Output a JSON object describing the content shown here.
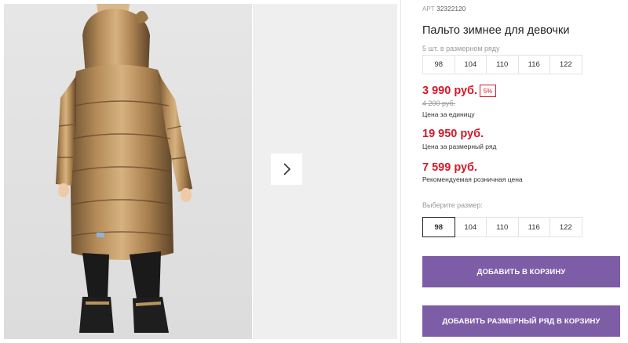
{
  "gallery": {
    "photo_alt": "girl in metallic gold winter coat, back view",
    "next_icon": "chevron-right-icon",
    "next_label": "›"
  },
  "product": {
    "article_label": "АРТ",
    "article_number": "32322120",
    "title": "Пальто зимнее для девочки",
    "pack_label": "5 шт. в размерном ряду",
    "pack_sizes": [
      "98",
      "104",
      "110",
      "116",
      "122"
    ],
    "unit_price": "3 990 руб.",
    "discount": "5%",
    "old_price": "4 200 руб.",
    "unit_price_note": "Цена за единицу",
    "pack_price": "19 950 руб.",
    "pack_price_note": "Цена за размерный ряд",
    "retail_price": "7 599 руб.",
    "retail_price_note": "Рекомендуемая розничная цена",
    "choose_size_label": "Выберите размер:",
    "sizes": [
      "98",
      "104",
      "110",
      "116",
      "122"
    ],
    "selected_size": "98",
    "add_to_cart": "ДОБАВИТЬ В КОРЗИНУ",
    "add_pack_to_cart": "ДОБАВИТЬ РАЗМЕРНЫЙ РЯД В КОРЗИНУ"
  },
  "colors": {
    "accent": "#7c5da6",
    "price_red": "#d21a2a",
    "coat_gold": "#b08755"
  }
}
